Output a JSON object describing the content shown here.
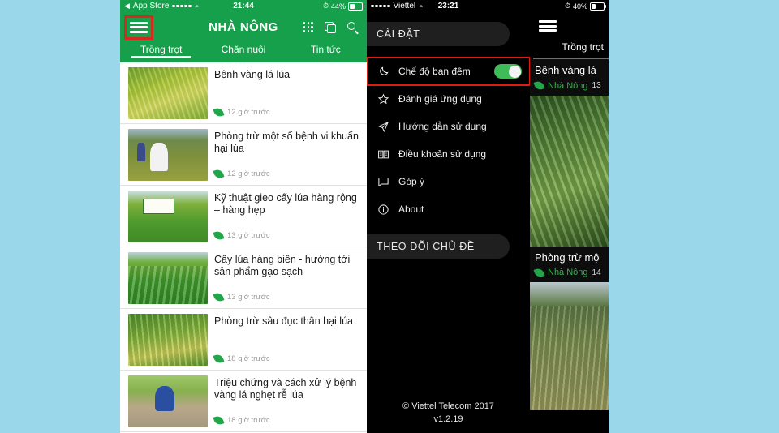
{
  "background_color": "#9ad7ea",
  "left_phone": {
    "status_bar": {
      "back_label": "App Store",
      "carrier_dots": 5,
      "wifi_icon": "wifi-icon",
      "time": "21:44",
      "alarm_icon": "alarm-icon",
      "battery_percent": "44%",
      "battery_level": 44
    },
    "app_bar": {
      "menu_icon": "hamburger-menu-icon",
      "title": "NHÀ NÔNG",
      "icons": [
        "grid-icon",
        "copy-icon",
        "search-icon"
      ],
      "highlighted": true,
      "highlight_color": "#d52b1e",
      "bar_color": "#17a04b"
    },
    "tabs": [
      {
        "label": "Trồng trọt",
        "active": true
      },
      {
        "label": "Chăn nuôi",
        "active": false
      },
      {
        "label": "Tin tức",
        "active": false
      }
    ],
    "feed": [
      {
        "title": "Bệnh vàng lá lúa",
        "time": "12 giờ trước",
        "thumb": "th1"
      },
      {
        "title": "Phòng trừ một số bệnh vi khuẩn hại lúa",
        "time": "12 giờ trước",
        "thumb": "th2"
      },
      {
        "title": "Kỹ thuật gieo cấy lúa hàng rộng – hàng hẹp",
        "time": "13 giờ trước",
        "thumb": "th3"
      },
      {
        "title": "Cấy lúa hàng biên - hướng tới sản phẩm gạo sạch",
        "time": "13 giờ trước",
        "thumb": "th4"
      },
      {
        "title": "Phòng trừ sâu đục thân hại lúa",
        "time": "18 giờ trước",
        "thumb": "th5"
      },
      {
        "title": "Triệu chứng và cách xử lý bệnh vàng lá nghẹt rễ lúa",
        "time": "18 giờ trước",
        "thumb": "th6"
      }
    ]
  },
  "middle_phone": {
    "status_bar": {
      "carrier_dots": 5,
      "carrier": "Viettel",
      "wifi_icon": "wifi-icon",
      "time": "23:21"
    },
    "settings_header": "CÀI ĐẶT",
    "menu": [
      {
        "label": "Chế độ ban đêm",
        "icon": "moon-icon",
        "has_toggle": true,
        "toggle_on": true,
        "highlighted": true
      },
      {
        "label": "Đánh giá ứng dụng",
        "icon": "star-icon",
        "has_toggle": false
      },
      {
        "label": "Hướng dẫn sử dụng",
        "icon": "paper-plane-icon",
        "has_toggle": false
      },
      {
        "label": "Điều khoản sử dụng",
        "icon": "book-icon",
        "has_toggle": false
      },
      {
        "label": "Góp ý",
        "icon": "chat-bubble-icon",
        "has_toggle": false
      },
      {
        "label": "About",
        "icon": "info-icon",
        "has_toggle": false
      }
    ],
    "follow_header": "THEO DÕI CHỦ ĐỀ",
    "footer_copyright": "© Viettel Telecom 2017",
    "footer_version": "v1.2.19",
    "toggle_on_color": "#3fbb57",
    "highlight_color": "#e01b12"
  },
  "right_phone": {
    "status_bar": {
      "alarm_icon": "alarm-icon",
      "battery_percent": "40%",
      "battery_level": 40
    },
    "app_bar": {
      "menu_icon": "hamburger-menu-icon"
    },
    "tab_label": "Trồng trọt",
    "cards": [
      {
        "title": "Bệnh vàng lá",
        "source": "Nhà Nông",
        "number": "13",
        "leaf_icon": "leaf-icon"
      },
      {
        "title": "Phòng trừ mộ",
        "source": "Nhà Nông",
        "number": "14",
        "leaf_icon": "leaf-icon"
      }
    ]
  }
}
